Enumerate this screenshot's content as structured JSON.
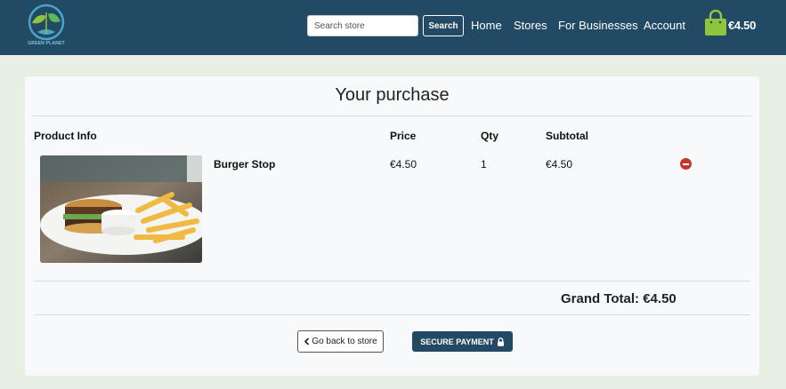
{
  "navbar": {
    "logo_text": "GREEN PLANET",
    "search_placeholder": "Search store",
    "search_button": "Search",
    "links": [
      "Home",
      "Stores",
      "For Businesses",
      "Account"
    ],
    "bag_total": "€4.50",
    "bag_icon": "shopping-bag-icon"
  },
  "purchase": {
    "title": "Your purchase",
    "headers": {
      "product_info": "Product Info",
      "price": "Price",
      "qty": "Qty",
      "subtotal": "Subtotal"
    },
    "items": [
      {
        "name": "Burger Stop",
        "price": "€4.50",
        "qty": "1",
        "subtotal": "€4.50",
        "image": "burger-and-fries-photo",
        "remove_icon": "remove-circle-icon"
      }
    ],
    "grand_total": "Grand Total: €4.50",
    "back_button": "Go back to store",
    "pay_button": "SECURE PAYMENT"
  },
  "colors": {
    "navbar": "#234a64",
    "page_background": "#e8efe3",
    "card": "#f8f9fa",
    "bag": "#8fc43f",
    "remove": "#c0392b"
  }
}
